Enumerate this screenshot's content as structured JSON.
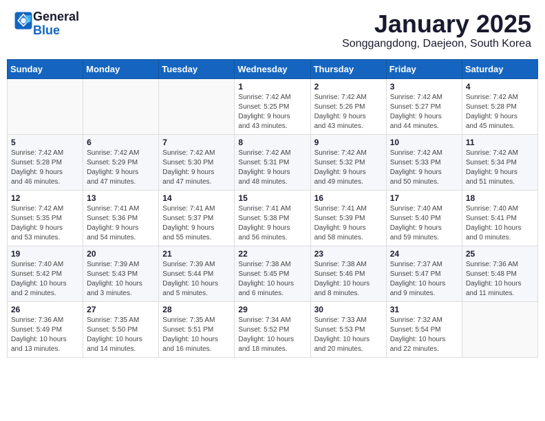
{
  "header": {
    "logo_line1": "General",
    "logo_line2": "Blue",
    "month_title": "January 2025",
    "subtitle": "Songgangdong, Daejeon, South Korea"
  },
  "weekdays": [
    "Sunday",
    "Monday",
    "Tuesday",
    "Wednesday",
    "Thursday",
    "Friday",
    "Saturday"
  ],
  "weeks": [
    [
      {
        "day": "",
        "info": ""
      },
      {
        "day": "",
        "info": ""
      },
      {
        "day": "",
        "info": ""
      },
      {
        "day": "1",
        "info": "Sunrise: 7:42 AM\nSunset: 5:25 PM\nDaylight: 9 hours\nand 43 minutes."
      },
      {
        "day": "2",
        "info": "Sunrise: 7:42 AM\nSunset: 5:26 PM\nDaylight: 9 hours\nand 43 minutes."
      },
      {
        "day": "3",
        "info": "Sunrise: 7:42 AM\nSunset: 5:27 PM\nDaylight: 9 hours\nand 44 minutes."
      },
      {
        "day": "4",
        "info": "Sunrise: 7:42 AM\nSunset: 5:28 PM\nDaylight: 9 hours\nand 45 minutes."
      }
    ],
    [
      {
        "day": "5",
        "info": "Sunrise: 7:42 AM\nSunset: 5:28 PM\nDaylight: 9 hours\nand 46 minutes."
      },
      {
        "day": "6",
        "info": "Sunrise: 7:42 AM\nSunset: 5:29 PM\nDaylight: 9 hours\nand 47 minutes."
      },
      {
        "day": "7",
        "info": "Sunrise: 7:42 AM\nSunset: 5:30 PM\nDaylight: 9 hours\nand 47 minutes."
      },
      {
        "day": "8",
        "info": "Sunrise: 7:42 AM\nSunset: 5:31 PM\nDaylight: 9 hours\nand 48 minutes."
      },
      {
        "day": "9",
        "info": "Sunrise: 7:42 AM\nSunset: 5:32 PM\nDaylight: 9 hours\nand 49 minutes."
      },
      {
        "day": "10",
        "info": "Sunrise: 7:42 AM\nSunset: 5:33 PM\nDaylight: 9 hours\nand 50 minutes."
      },
      {
        "day": "11",
        "info": "Sunrise: 7:42 AM\nSunset: 5:34 PM\nDaylight: 9 hours\nand 51 minutes."
      }
    ],
    [
      {
        "day": "12",
        "info": "Sunrise: 7:42 AM\nSunset: 5:35 PM\nDaylight: 9 hours\nand 53 minutes."
      },
      {
        "day": "13",
        "info": "Sunrise: 7:41 AM\nSunset: 5:36 PM\nDaylight: 9 hours\nand 54 minutes."
      },
      {
        "day": "14",
        "info": "Sunrise: 7:41 AM\nSunset: 5:37 PM\nDaylight: 9 hours\nand 55 minutes."
      },
      {
        "day": "15",
        "info": "Sunrise: 7:41 AM\nSunset: 5:38 PM\nDaylight: 9 hours\nand 56 minutes."
      },
      {
        "day": "16",
        "info": "Sunrise: 7:41 AM\nSunset: 5:39 PM\nDaylight: 9 hours\nand 58 minutes."
      },
      {
        "day": "17",
        "info": "Sunrise: 7:40 AM\nSunset: 5:40 PM\nDaylight: 9 hours\nand 59 minutes."
      },
      {
        "day": "18",
        "info": "Sunrise: 7:40 AM\nSunset: 5:41 PM\nDaylight: 10 hours\nand 0 minutes."
      }
    ],
    [
      {
        "day": "19",
        "info": "Sunrise: 7:40 AM\nSunset: 5:42 PM\nDaylight: 10 hours\nand 2 minutes."
      },
      {
        "day": "20",
        "info": "Sunrise: 7:39 AM\nSunset: 5:43 PM\nDaylight: 10 hours\nand 3 minutes."
      },
      {
        "day": "21",
        "info": "Sunrise: 7:39 AM\nSunset: 5:44 PM\nDaylight: 10 hours\nand 5 minutes."
      },
      {
        "day": "22",
        "info": "Sunrise: 7:38 AM\nSunset: 5:45 PM\nDaylight: 10 hours\nand 6 minutes."
      },
      {
        "day": "23",
        "info": "Sunrise: 7:38 AM\nSunset: 5:46 PM\nDaylight: 10 hours\nand 8 minutes."
      },
      {
        "day": "24",
        "info": "Sunrise: 7:37 AM\nSunset: 5:47 PM\nDaylight: 10 hours\nand 9 minutes."
      },
      {
        "day": "25",
        "info": "Sunrise: 7:36 AM\nSunset: 5:48 PM\nDaylight: 10 hours\nand 11 minutes."
      }
    ],
    [
      {
        "day": "26",
        "info": "Sunrise: 7:36 AM\nSunset: 5:49 PM\nDaylight: 10 hours\nand 13 minutes."
      },
      {
        "day": "27",
        "info": "Sunrise: 7:35 AM\nSunset: 5:50 PM\nDaylight: 10 hours\nand 14 minutes."
      },
      {
        "day": "28",
        "info": "Sunrise: 7:35 AM\nSunset: 5:51 PM\nDaylight: 10 hours\nand 16 minutes."
      },
      {
        "day": "29",
        "info": "Sunrise: 7:34 AM\nSunset: 5:52 PM\nDaylight: 10 hours\nand 18 minutes."
      },
      {
        "day": "30",
        "info": "Sunrise: 7:33 AM\nSunset: 5:53 PM\nDaylight: 10 hours\nand 20 minutes."
      },
      {
        "day": "31",
        "info": "Sunrise: 7:32 AM\nSunset: 5:54 PM\nDaylight: 10 hours\nand 22 minutes."
      },
      {
        "day": "",
        "info": ""
      }
    ]
  ]
}
